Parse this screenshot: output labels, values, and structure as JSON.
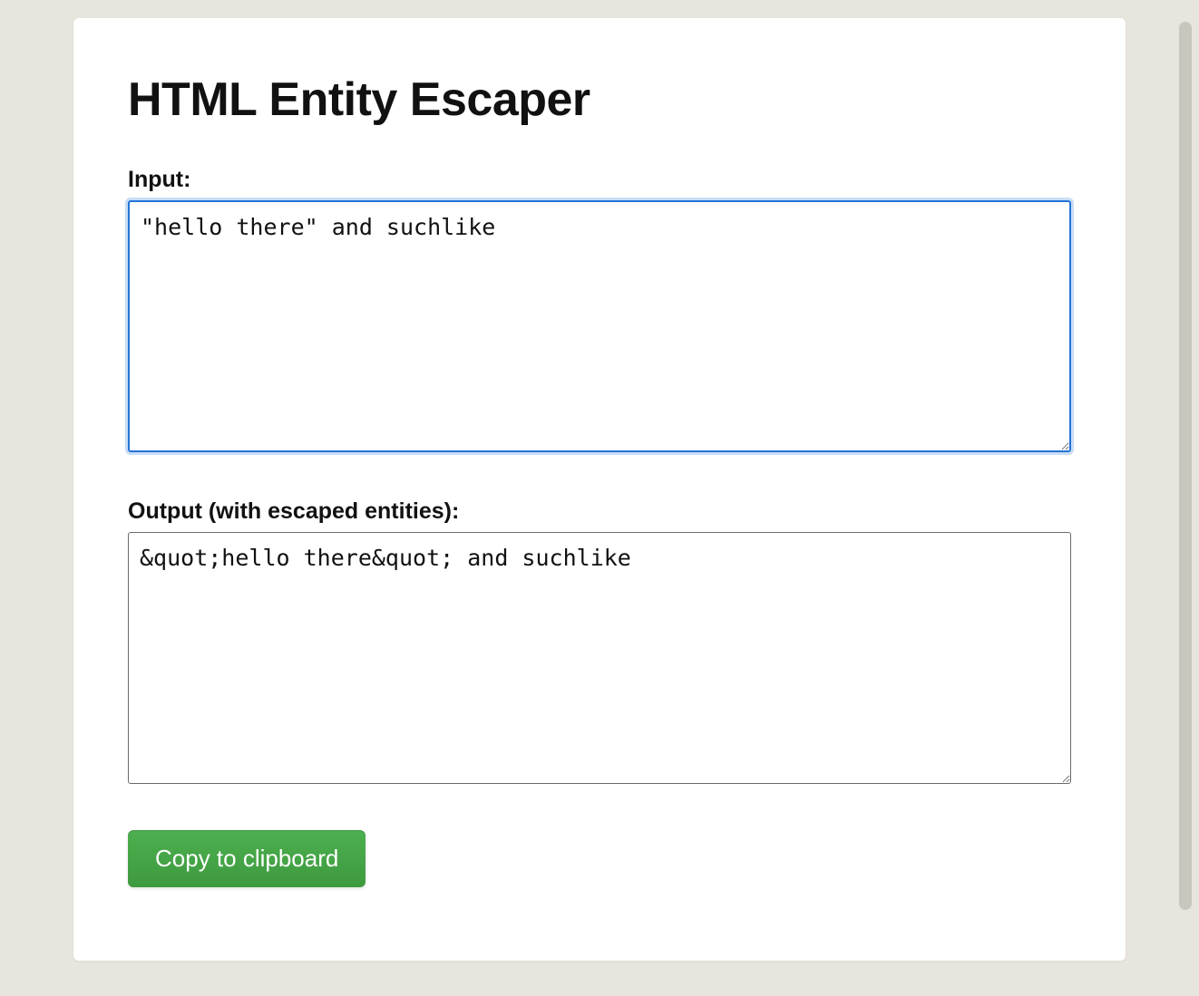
{
  "page": {
    "title": "HTML Entity Escaper"
  },
  "input": {
    "label": "Input:",
    "value": "\"hello there\" and suchlike"
  },
  "output": {
    "label": "Output (with escaped entities):",
    "value": "&quot;hello there&quot; and suchlike"
  },
  "actions": {
    "copy_label": "Copy to clipboard"
  },
  "colors": {
    "background": "#e8e5de",
    "card": "#ffffff",
    "focus_border": "#2474d6",
    "button_bg": "#44a544",
    "button_text": "#ffffff"
  }
}
